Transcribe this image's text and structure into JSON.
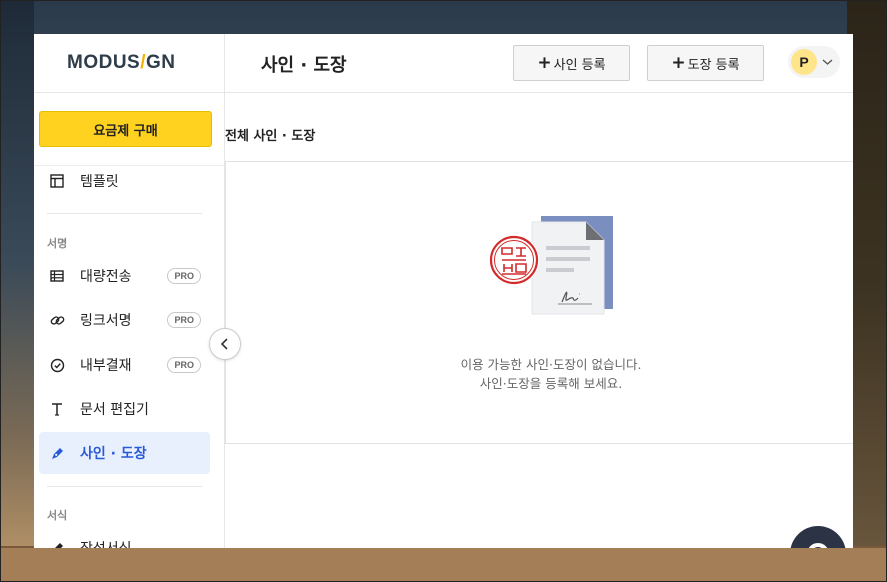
{
  "app": {
    "logo_main": "MODUS",
    "logo_slash": "/",
    "logo_tail": "GN"
  },
  "sidebar": {
    "purchase_label": "요금제 구매",
    "items": [
      {
        "label": "템플릿",
        "icon": "template-icon"
      },
      {
        "label": "대량전송",
        "icon": "table-icon",
        "badge": "PRO"
      },
      {
        "label": "링크서명",
        "icon": "link-icon",
        "badge": "PRO"
      },
      {
        "label": "내부결재",
        "icon": "check-circle-icon",
        "badge": "PRO"
      },
      {
        "label": "문서 편집기",
        "icon": "text-icon"
      },
      {
        "label": "사인 · 도장",
        "icon": "pen-icon",
        "active": true
      },
      {
        "label": "작성서식",
        "icon": "pen-icon"
      }
    ],
    "section_sign": "서명",
    "section_form": "서식"
  },
  "header": {
    "title": "사인 · 도장",
    "add_sign_label": "사인 등록",
    "add_stamp_label": "도장 등록",
    "avatar_initial": "P"
  },
  "main": {
    "subheader": "전체 사인 · 도장",
    "empty_line1": "이용 가능한 사인·도장이 없습니다.",
    "empty_line2": "사인·도장을 등록해 보세요."
  },
  "colors": {
    "accent_yellow": "#ffd21f",
    "active_blue": "#2a5bd7",
    "stamp_red": "#d42b2b",
    "doc_blue": "#7a8fc0"
  }
}
